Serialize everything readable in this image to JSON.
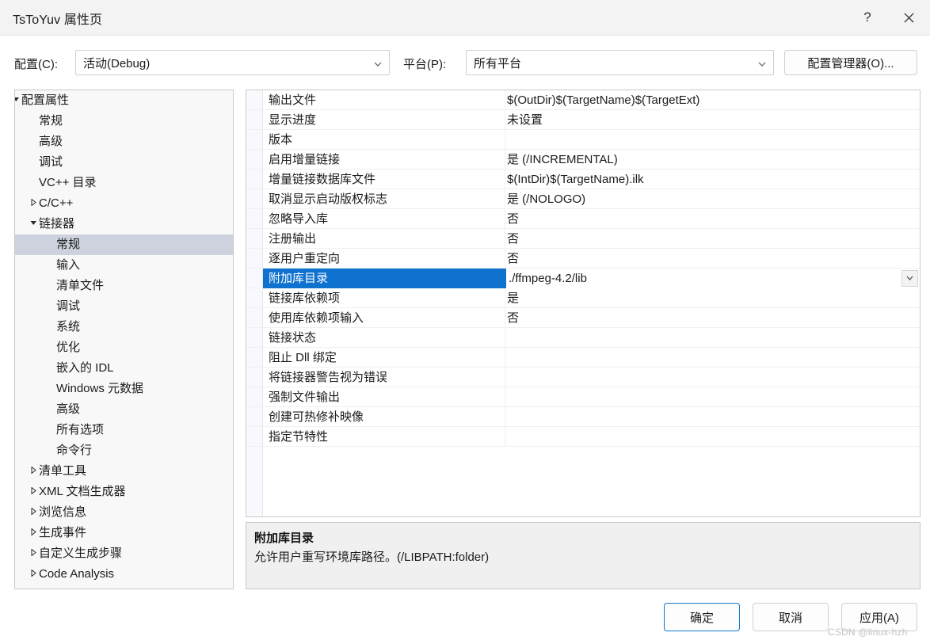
{
  "window": {
    "title": "TsToYuv 属性页",
    "help_icon": "question-mark-icon",
    "close_icon": "close-icon"
  },
  "configbar": {
    "config_label": "配置(C):",
    "config_value": "活动(Debug)",
    "platform_label": "平台(P):",
    "platform_value": "所有平台",
    "config_manager_button": "配置管理器(O)..."
  },
  "tree": {
    "items": [
      {
        "label": "配置属性",
        "indent": 0,
        "twisty": "expanded",
        "selected": false
      },
      {
        "label": "常规",
        "indent": 1,
        "twisty": "none",
        "selected": false
      },
      {
        "label": "高级",
        "indent": 1,
        "twisty": "none",
        "selected": false
      },
      {
        "label": "调试",
        "indent": 1,
        "twisty": "none",
        "selected": false
      },
      {
        "label": "VC++ 目录",
        "indent": 1,
        "twisty": "none",
        "selected": false
      },
      {
        "label": "C/C++",
        "indent": 1,
        "twisty": "collapsed",
        "selected": false
      },
      {
        "label": "链接器",
        "indent": 1,
        "twisty": "expanded",
        "selected": false
      },
      {
        "label": "常规",
        "indent": 2,
        "twisty": "none",
        "selected": true
      },
      {
        "label": "输入",
        "indent": 2,
        "twisty": "none",
        "selected": false
      },
      {
        "label": "清单文件",
        "indent": 2,
        "twisty": "none",
        "selected": false
      },
      {
        "label": "调试",
        "indent": 2,
        "twisty": "none",
        "selected": false
      },
      {
        "label": "系统",
        "indent": 2,
        "twisty": "none",
        "selected": false
      },
      {
        "label": "优化",
        "indent": 2,
        "twisty": "none",
        "selected": false
      },
      {
        "label": "嵌入的 IDL",
        "indent": 2,
        "twisty": "none",
        "selected": false
      },
      {
        "label": "Windows 元数据",
        "indent": 2,
        "twisty": "none",
        "selected": false
      },
      {
        "label": "高级",
        "indent": 2,
        "twisty": "none",
        "selected": false
      },
      {
        "label": "所有选项",
        "indent": 2,
        "twisty": "none",
        "selected": false
      },
      {
        "label": "命令行",
        "indent": 2,
        "twisty": "none",
        "selected": false
      },
      {
        "label": "清单工具",
        "indent": 1,
        "twisty": "collapsed",
        "selected": false
      },
      {
        "label": "XML 文档生成器",
        "indent": 1,
        "twisty": "collapsed",
        "selected": false
      },
      {
        "label": "浏览信息",
        "indent": 1,
        "twisty": "collapsed",
        "selected": false
      },
      {
        "label": "生成事件",
        "indent": 1,
        "twisty": "collapsed",
        "selected": false
      },
      {
        "label": "自定义生成步骤",
        "indent": 1,
        "twisty": "collapsed",
        "selected": false
      },
      {
        "label": "Code Analysis",
        "indent": 1,
        "twisty": "collapsed",
        "selected": false
      }
    ]
  },
  "grid": {
    "rows": [
      {
        "name": "输出文件",
        "value": "$(OutDir)$(TargetName)$(TargetExt)",
        "selected": false
      },
      {
        "name": "显示进度",
        "value": "未设置",
        "selected": false
      },
      {
        "name": "版本",
        "value": "",
        "selected": false
      },
      {
        "name": "启用增量链接",
        "value": "是 (/INCREMENTAL)",
        "selected": false
      },
      {
        "name": "增量链接数据库文件",
        "value": "$(IntDir)$(TargetName).ilk",
        "selected": false
      },
      {
        "name": "取消显示启动版权标志",
        "value": "是 (/NOLOGO)",
        "selected": false
      },
      {
        "name": "忽略导入库",
        "value": "否",
        "selected": false
      },
      {
        "name": "注册输出",
        "value": "否",
        "selected": false
      },
      {
        "name": "逐用户重定向",
        "value": "否",
        "selected": false
      },
      {
        "name": "附加库目录",
        "value": "./ffmpeg-4.2/lib",
        "selected": true
      },
      {
        "name": "链接库依赖项",
        "value": "是",
        "selected": false
      },
      {
        "name": "使用库依赖项输入",
        "value": "否",
        "selected": false
      },
      {
        "name": "链接状态",
        "value": "",
        "selected": false
      },
      {
        "name": "阻止 Dll 绑定",
        "value": "",
        "selected": false
      },
      {
        "name": "将链接器警告视为错误",
        "value": "",
        "selected": false
      },
      {
        "name": "强制文件输出",
        "value": "",
        "selected": false
      },
      {
        "name": "创建可热修补映像",
        "value": "",
        "selected": false
      },
      {
        "name": "指定节特性",
        "value": "",
        "selected": false
      }
    ],
    "dropdown_icon": "chevron-down-icon"
  },
  "description": {
    "title": "附加库目录",
    "text": "允许用户重写环境库路径。(/LIBPATH:folder)"
  },
  "footer": {
    "ok": "确定",
    "cancel": "取消",
    "apply": "应用(A)"
  },
  "watermark": "CSDN @linux-hzh",
  "colors": {
    "selection_blue": "#0f72cf",
    "tree_selection": "#cdd2de",
    "titlebar": "#f3f3f3",
    "description_panel": "#f0f0f0"
  }
}
